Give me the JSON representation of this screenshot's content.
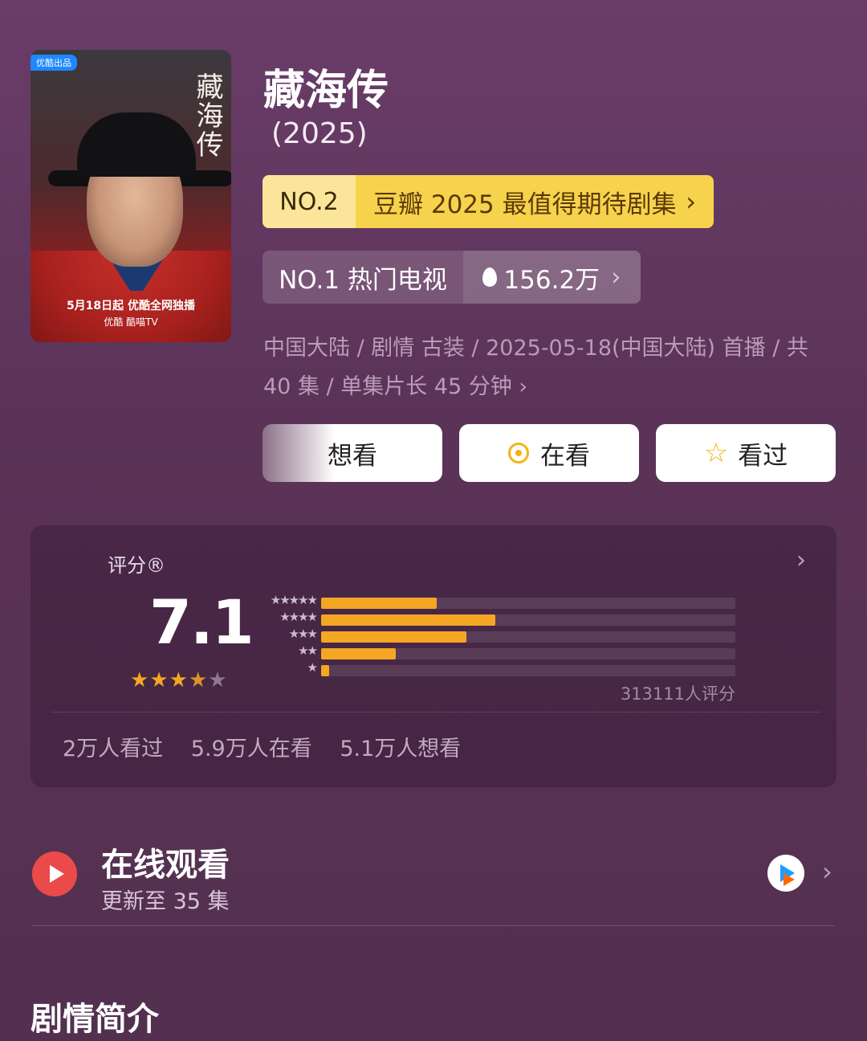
{
  "poster": {
    "badge": "优酷出品",
    "title": "藏海传",
    "release_text": "5月18日起 优酷全网独播",
    "platforms": "优酷  酷喵TV"
  },
  "show": {
    "title": "藏海传",
    "year": "(2025)"
  },
  "rank1": {
    "no": "NO.2",
    "desc": "豆瓣 2025 最值得期待剧集",
    "chev": "›"
  },
  "rank2": {
    "left": "NO.1 热门电视",
    "right": "156.2万",
    "chev": "›"
  },
  "meta": "中国大陆 / 剧情 古装 / 2025-05-18(中国大陆) 首播 / 共 40 集 / 单集片长 45 分钟 ›",
  "actions": {
    "want": "想看",
    "watching": "在看",
    "watched": "看过"
  },
  "rating": {
    "label": "评分®",
    "score": "7.1",
    "stars_filled": 3.5,
    "stars_total": 5,
    "count_text": "313111人评分",
    "distribution": [
      {
        "label": "★★★★★",
        "fraction": 0.28
      },
      {
        "label": "★★★★",
        "fraction": 0.42
      },
      {
        "label": "★★★",
        "fraction": 0.35
      },
      {
        "label": "★★",
        "fraction": 0.18
      },
      {
        "label": "★",
        "fraction": 0.02
      }
    ],
    "stats": [
      "2万人看过",
      "5.9万人在看",
      "5.1万人想看"
    ]
  },
  "online": {
    "title": "在线观看",
    "subtitle": "更新至 35 集",
    "chev": "›"
  },
  "section_title": "剧情简介",
  "colors": {
    "accent": "#f5a623",
    "background": "#5b3358",
    "rank_gold": "#f7d24d"
  }
}
